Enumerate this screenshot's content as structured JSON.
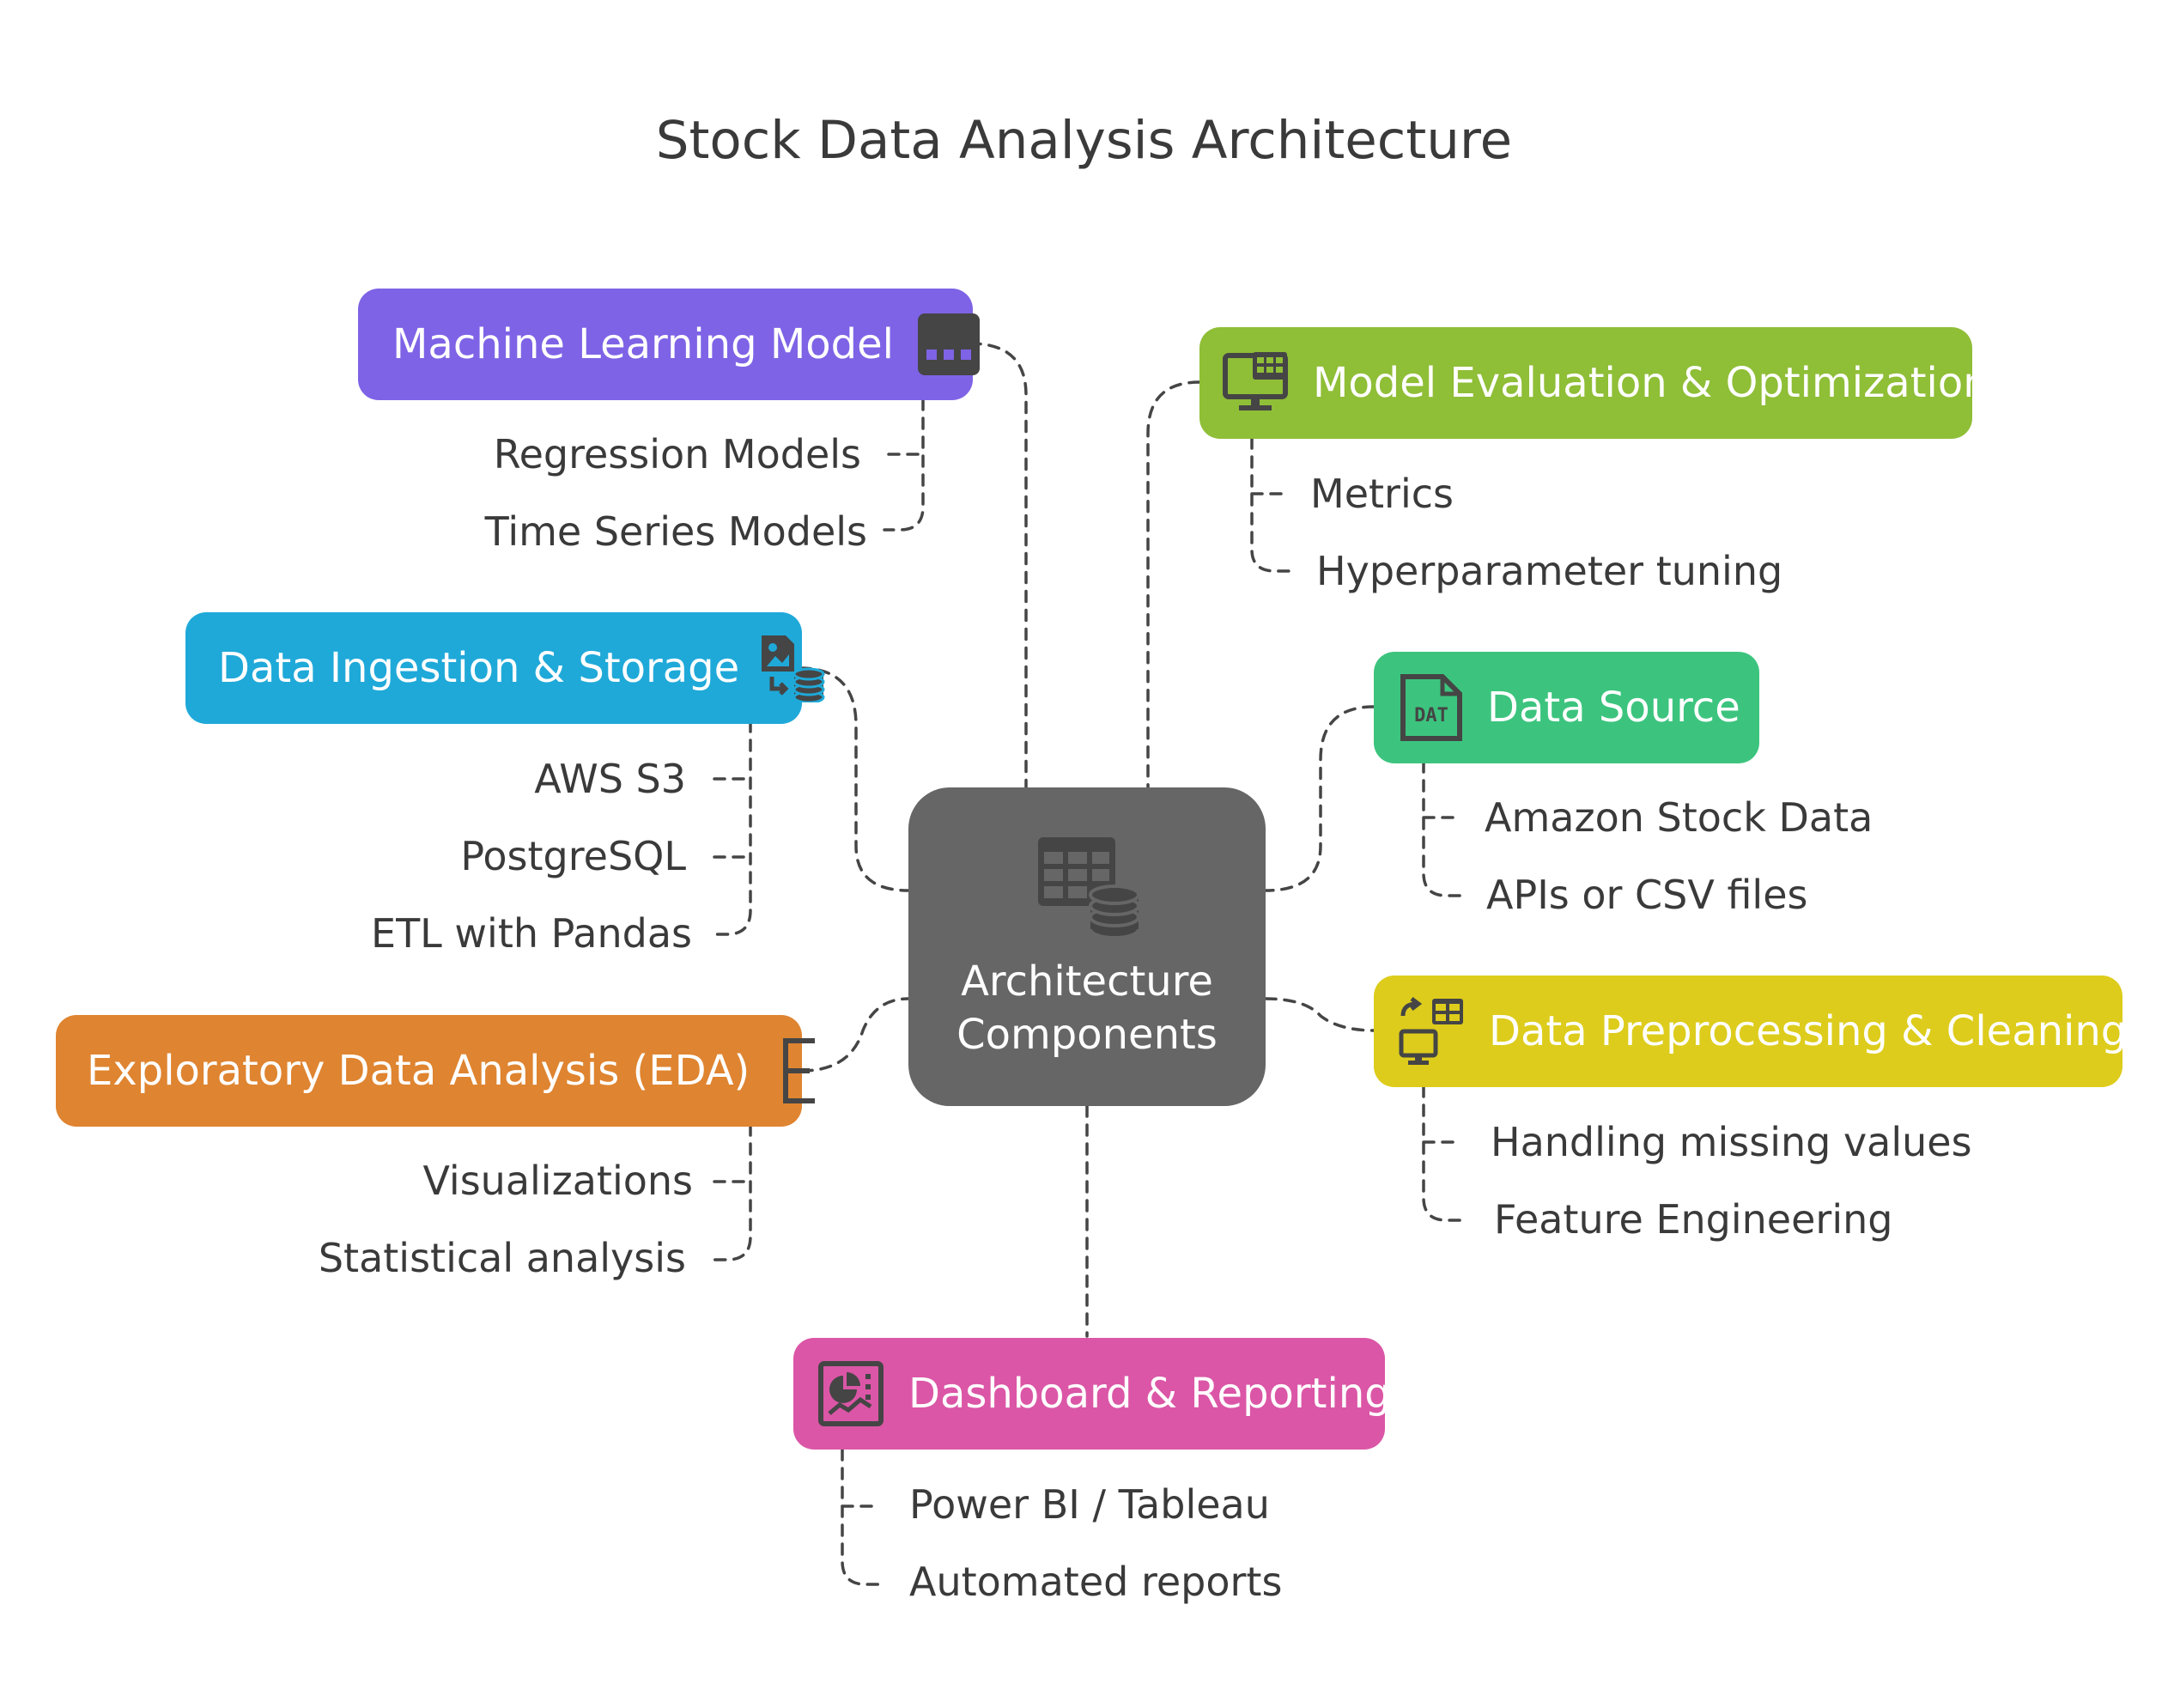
{
  "title": "Stock Data Analysis Architecture",
  "center": {
    "label_line1": "Architecture",
    "label_line2": "Components",
    "icon": "table-database-icon"
  },
  "colors": {
    "center": "#666666",
    "machine_learning": "#7E63E6",
    "model_evaluation": "#8FBE37",
    "data_ingestion": "#1FA9D9",
    "data_source": "#3CC47E",
    "eda": "#DF8430",
    "preprocessing": "#DDCC1C",
    "dashboard": "#DB56A6",
    "icon_dark": "#454545"
  },
  "nodes": {
    "machine_learning": {
      "label": "Machine Learning Model",
      "icon": "model-dots-icon",
      "items": [
        "Regression Models",
        "Time Series Models"
      ]
    },
    "model_evaluation": {
      "label": "Model Evaluation & Optimization",
      "icon": "monitor-grid-icon",
      "items": [
        "Metrics",
        "Hyperparameter tuning"
      ]
    },
    "data_ingestion": {
      "label": "Data Ingestion & Storage",
      "icon": "file-transfer-database-icon",
      "items": [
        "AWS S3",
        "PostgreSQL",
        "ETL with Pandas"
      ]
    },
    "data_source": {
      "label": "Data Source",
      "icon": "dat-file-icon",
      "icon_text": "DAT",
      "items": [
        "Amazon Stock Data",
        "APIs or CSV files"
      ]
    },
    "eda": {
      "label": "Exploratory Data Analysis (EDA)",
      "icon": "letter-e-icon",
      "items": [
        "Visualizations",
        "Statistical analysis"
      ]
    },
    "preprocessing": {
      "label": "Data Preprocessing & Cleaning",
      "icon": "transfer-monitor-icon",
      "items": [
        "Handling missing values",
        "Feature Engineering"
      ]
    },
    "dashboard": {
      "label": "Dashboard & Reporting",
      "icon": "pie-chart-report-icon",
      "items": [
        "Power BI / Tableau",
        "Automated reports"
      ]
    }
  }
}
